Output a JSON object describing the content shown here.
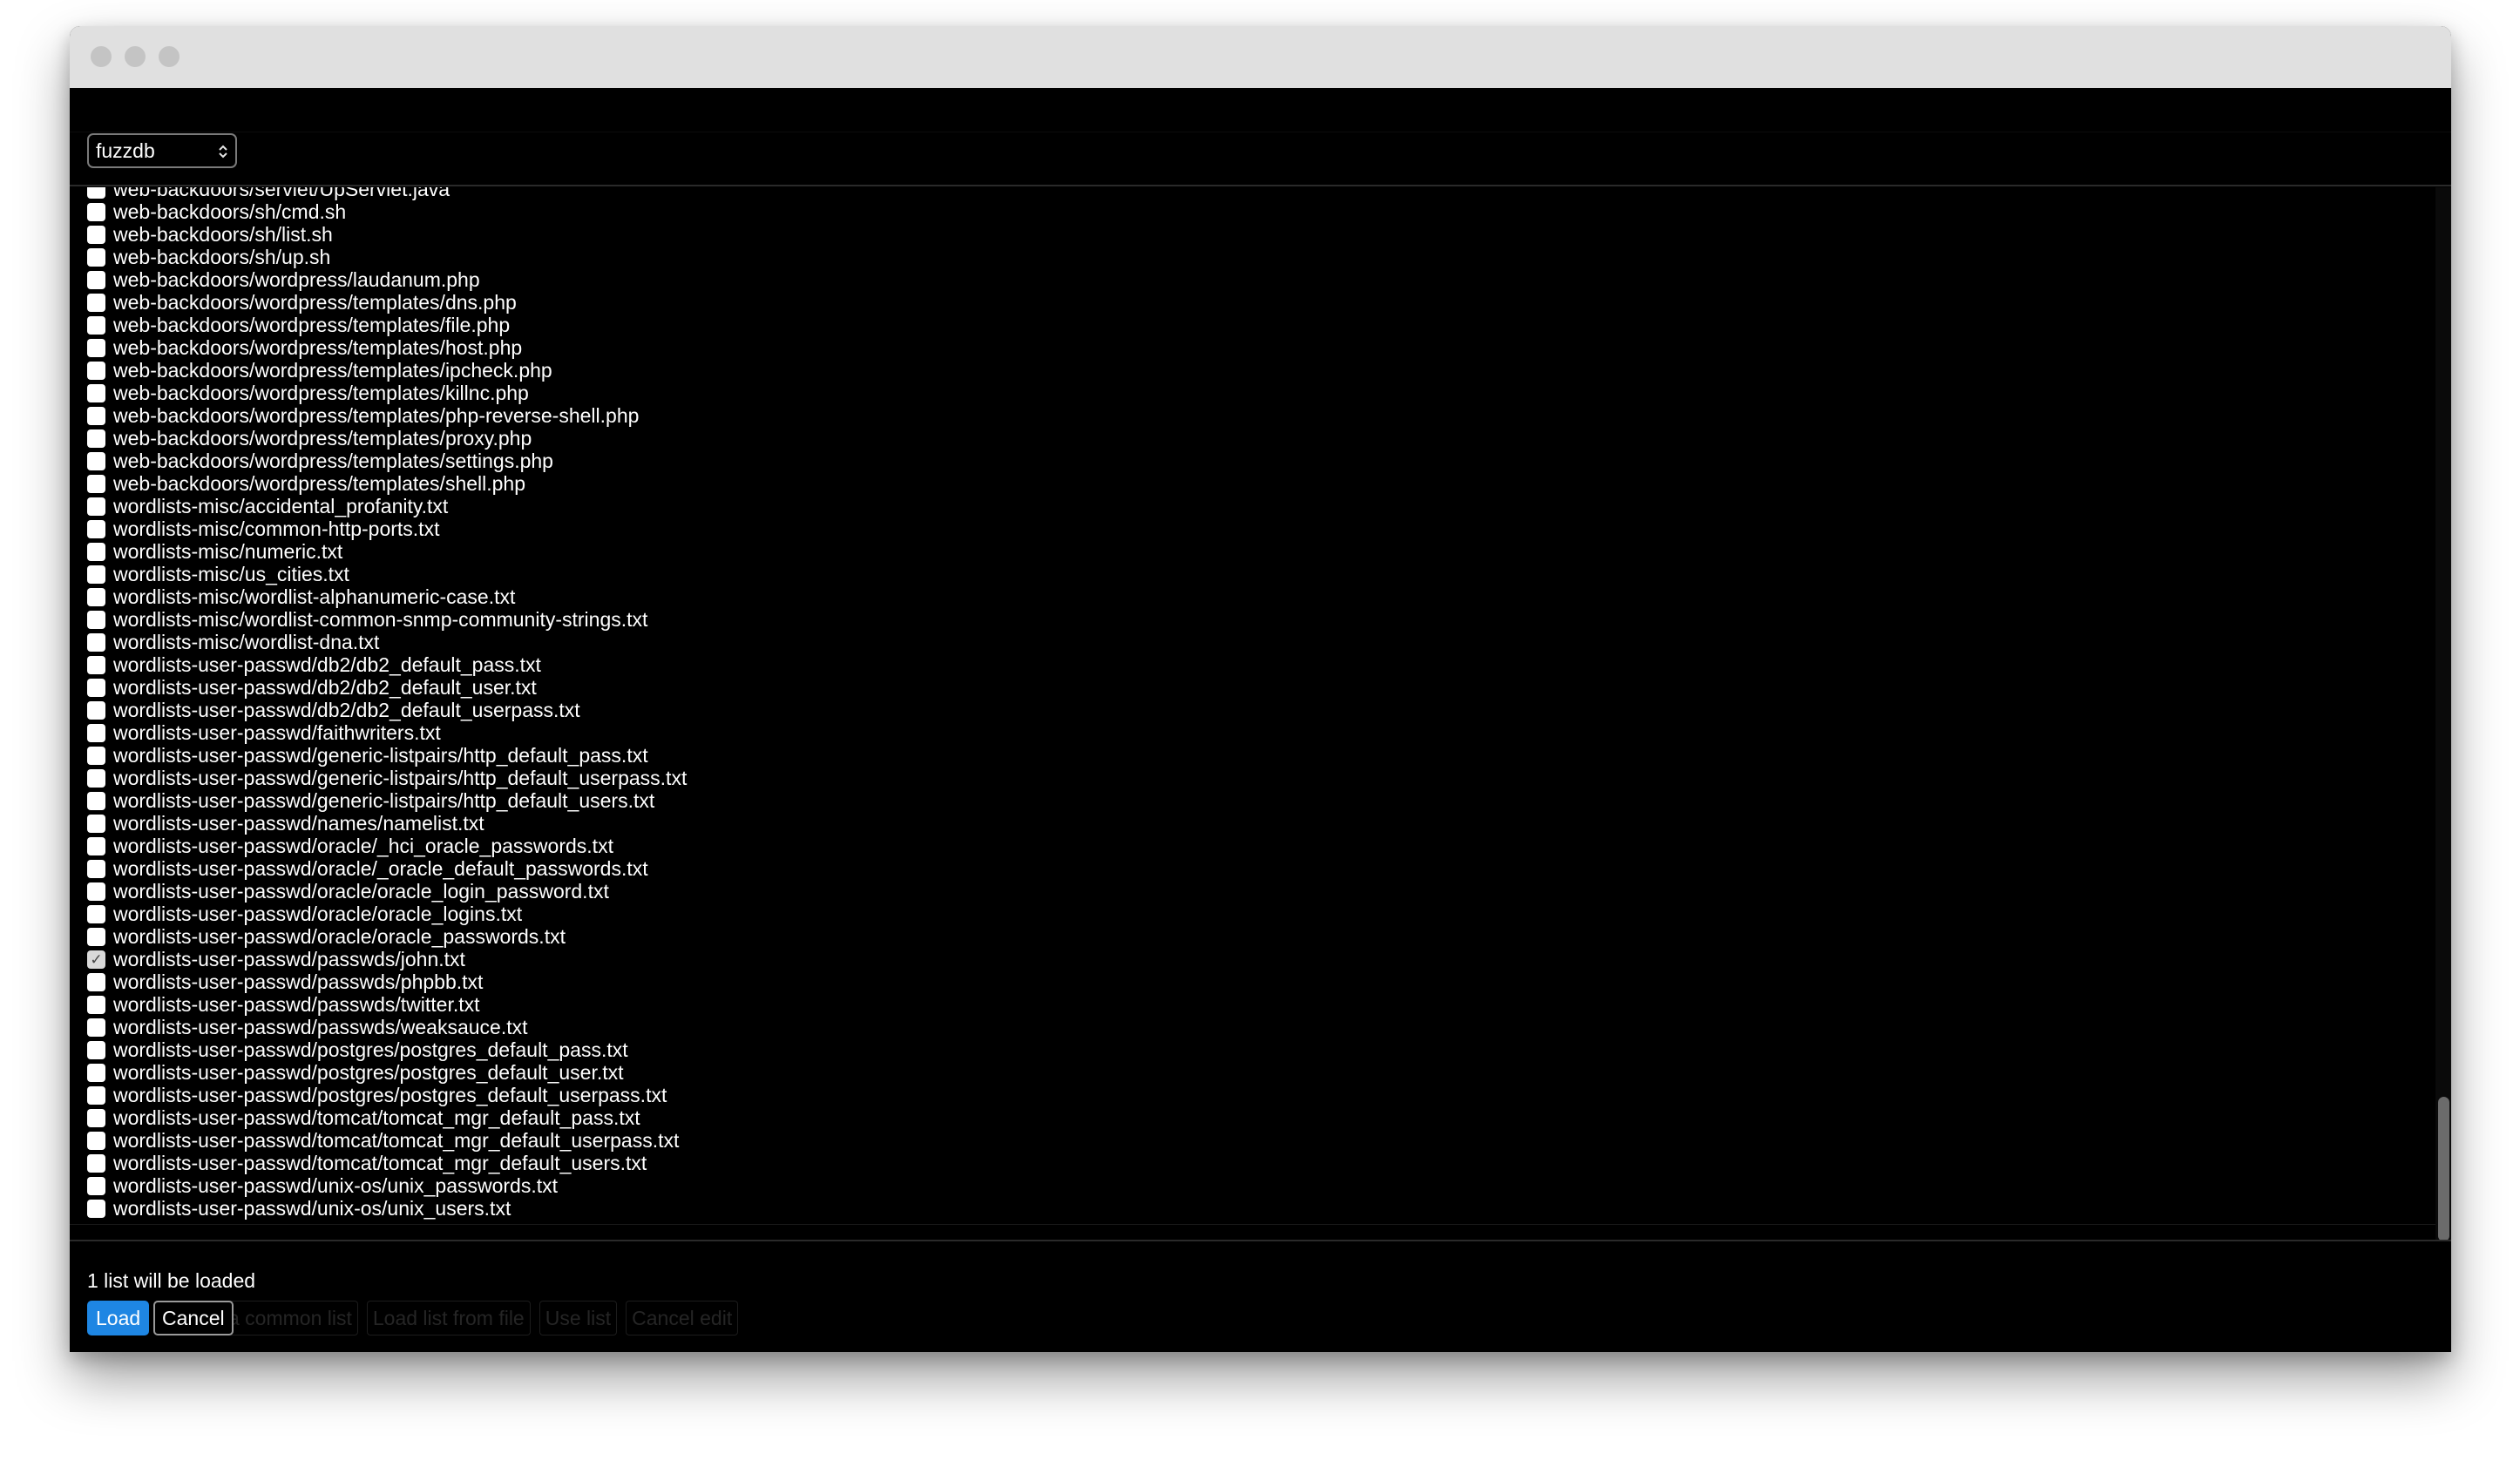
{
  "window": {
    "controls": [
      "close-dot",
      "minimize-dot",
      "maximize-dot"
    ]
  },
  "header": {
    "source_select": {
      "value": "fuzzdb",
      "chevron": "⌃⌄"
    }
  },
  "file_list": {
    "items": [
      {
        "path": "web-backdoors/servlet/UpServlet.java",
        "checked": false
      },
      {
        "path": "web-backdoors/sh/cmd.sh",
        "checked": false
      },
      {
        "path": "web-backdoors/sh/list.sh",
        "checked": false
      },
      {
        "path": "web-backdoors/sh/up.sh",
        "checked": false
      },
      {
        "path": "web-backdoors/wordpress/laudanum.php",
        "checked": false
      },
      {
        "path": "web-backdoors/wordpress/templates/dns.php",
        "checked": false
      },
      {
        "path": "web-backdoors/wordpress/templates/file.php",
        "checked": false
      },
      {
        "path": "web-backdoors/wordpress/templates/host.php",
        "checked": false
      },
      {
        "path": "web-backdoors/wordpress/templates/ipcheck.php",
        "checked": false
      },
      {
        "path": "web-backdoors/wordpress/templates/killnc.php",
        "checked": false
      },
      {
        "path": "web-backdoors/wordpress/templates/php-reverse-shell.php",
        "checked": false
      },
      {
        "path": "web-backdoors/wordpress/templates/proxy.php",
        "checked": false
      },
      {
        "path": "web-backdoors/wordpress/templates/settings.php",
        "checked": false
      },
      {
        "path": "web-backdoors/wordpress/templates/shell.php",
        "checked": false
      },
      {
        "path": "wordlists-misc/accidental_profanity.txt",
        "checked": false
      },
      {
        "path": "wordlists-misc/common-http-ports.txt",
        "checked": false
      },
      {
        "path": "wordlists-misc/numeric.txt",
        "checked": false
      },
      {
        "path": "wordlists-misc/us_cities.txt",
        "checked": false
      },
      {
        "path": "wordlists-misc/wordlist-alphanumeric-case.txt",
        "checked": false
      },
      {
        "path": "wordlists-misc/wordlist-common-snmp-community-strings.txt",
        "checked": false
      },
      {
        "path": "wordlists-misc/wordlist-dna.txt",
        "checked": false
      },
      {
        "path": "wordlists-user-passwd/db2/db2_default_pass.txt",
        "checked": false
      },
      {
        "path": "wordlists-user-passwd/db2/db2_default_user.txt",
        "checked": false
      },
      {
        "path": "wordlists-user-passwd/db2/db2_default_userpass.txt",
        "checked": false
      },
      {
        "path": "wordlists-user-passwd/faithwriters.txt",
        "checked": false
      },
      {
        "path": "wordlists-user-passwd/generic-listpairs/http_default_pass.txt",
        "checked": false
      },
      {
        "path": "wordlists-user-passwd/generic-listpairs/http_default_userpass.txt",
        "checked": false
      },
      {
        "path": "wordlists-user-passwd/generic-listpairs/http_default_users.txt",
        "checked": false
      },
      {
        "path": "wordlists-user-passwd/names/namelist.txt",
        "checked": false
      },
      {
        "path": "wordlists-user-passwd/oracle/_hci_oracle_passwords.txt",
        "checked": false
      },
      {
        "path": "wordlists-user-passwd/oracle/_oracle_default_passwords.txt",
        "checked": false
      },
      {
        "path": "wordlists-user-passwd/oracle/oracle_login_password.txt",
        "checked": false
      },
      {
        "path": "wordlists-user-passwd/oracle/oracle_logins.txt",
        "checked": false
      },
      {
        "path": "wordlists-user-passwd/oracle/oracle_passwords.txt",
        "checked": false
      },
      {
        "path": "wordlists-user-passwd/passwds/john.txt",
        "checked": true
      },
      {
        "path": "wordlists-user-passwd/passwds/phpbb.txt",
        "checked": false
      },
      {
        "path": "wordlists-user-passwd/passwds/twitter.txt",
        "checked": false
      },
      {
        "path": "wordlists-user-passwd/passwds/weaksauce.txt",
        "checked": false
      },
      {
        "path": "wordlists-user-passwd/postgres/postgres_default_pass.txt",
        "checked": false
      },
      {
        "path": "wordlists-user-passwd/postgres/postgres_default_user.txt",
        "checked": false
      },
      {
        "path": "wordlists-user-passwd/postgres/postgres_default_userpass.txt",
        "checked": false
      },
      {
        "path": "wordlists-user-passwd/tomcat/tomcat_mgr_default_pass.txt",
        "checked": false
      },
      {
        "path": "wordlists-user-passwd/tomcat/tomcat_mgr_default_userpass.txt",
        "checked": false
      },
      {
        "path": "wordlists-user-passwd/tomcat/tomcat_mgr_default_users.txt",
        "checked": false
      },
      {
        "path": "wordlists-user-passwd/unix-os/unix_passwords.txt",
        "checked": false
      },
      {
        "path": "wordlists-user-passwd/unix-os/unix_users.txt",
        "checked": false
      }
    ],
    "check_glyph": "✓"
  },
  "footer": {
    "status": "1 list will be loaded",
    "load_label": "Load",
    "cancel_label": "Cancel",
    "background_buttons": [
      "a common list",
      "Load list from file",
      "Use list",
      "Cancel edit"
    ]
  },
  "colors": {
    "background": "#000000",
    "titlebar": "#e0e0e0",
    "accent": "#1e86e3",
    "text": "#ffffff"
  }
}
